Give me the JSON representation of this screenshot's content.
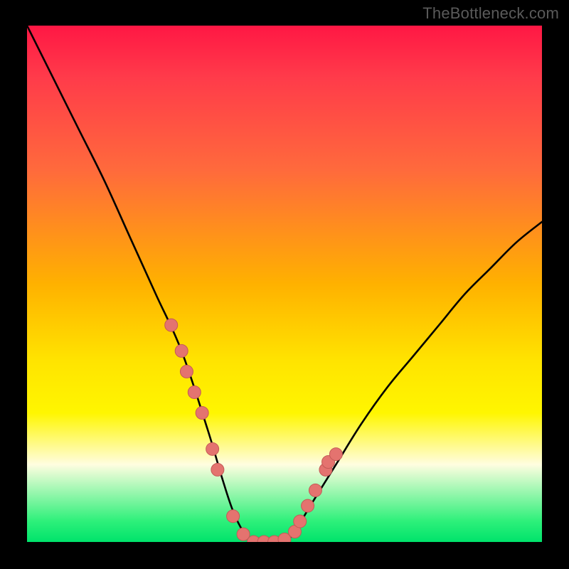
{
  "attribution": "TheBottleneck.com",
  "colors": {
    "page_bg": "#000000",
    "curve": "#000000",
    "marker_fill": "#e4736f",
    "marker_stroke": "#c45a56",
    "gradient_top": "#ff1744",
    "gradient_mid_high": "#ff6a3c",
    "gradient_mid": "#ffe400",
    "gradient_mid_low": "#fffde0",
    "gradient_bottom": "#00e36b"
  },
  "chart_data": {
    "type": "line",
    "title": "",
    "xlabel": "",
    "ylabel": "",
    "xlim": [
      0,
      100
    ],
    "ylim": [
      0,
      100
    ],
    "series": [
      {
        "name": "bottleneck-curve",
        "x": [
          0,
          5,
          10,
          15,
          20,
          25,
          30,
          35,
          38,
          40,
          42,
          44,
          46,
          48,
          50,
          52,
          55,
          60,
          65,
          70,
          75,
          80,
          85,
          90,
          95,
          100
        ],
        "y": [
          100,
          90,
          80,
          70,
          59,
          48,
          37,
          22,
          12,
          6,
          2,
          0,
          0,
          0,
          0,
          2,
          7,
          15,
          23,
          30,
          36,
          42,
          48,
          53,
          58,
          62
        ]
      }
    ],
    "markers": {
      "name": "highlighted-points",
      "x": [
        28,
        30,
        31,
        32.5,
        34,
        36,
        37,
        40,
        42,
        44,
        46,
        48,
        50,
        52,
        53,
        54.5,
        56,
        58,
        58.5,
        60
      ],
      "y": [
        42,
        37,
        33,
        29,
        25,
        18,
        14,
        5,
        1.5,
        0,
        0,
        0,
        0.5,
        2,
        4,
        7,
        10,
        14,
        15.5,
        17
      ]
    }
  }
}
